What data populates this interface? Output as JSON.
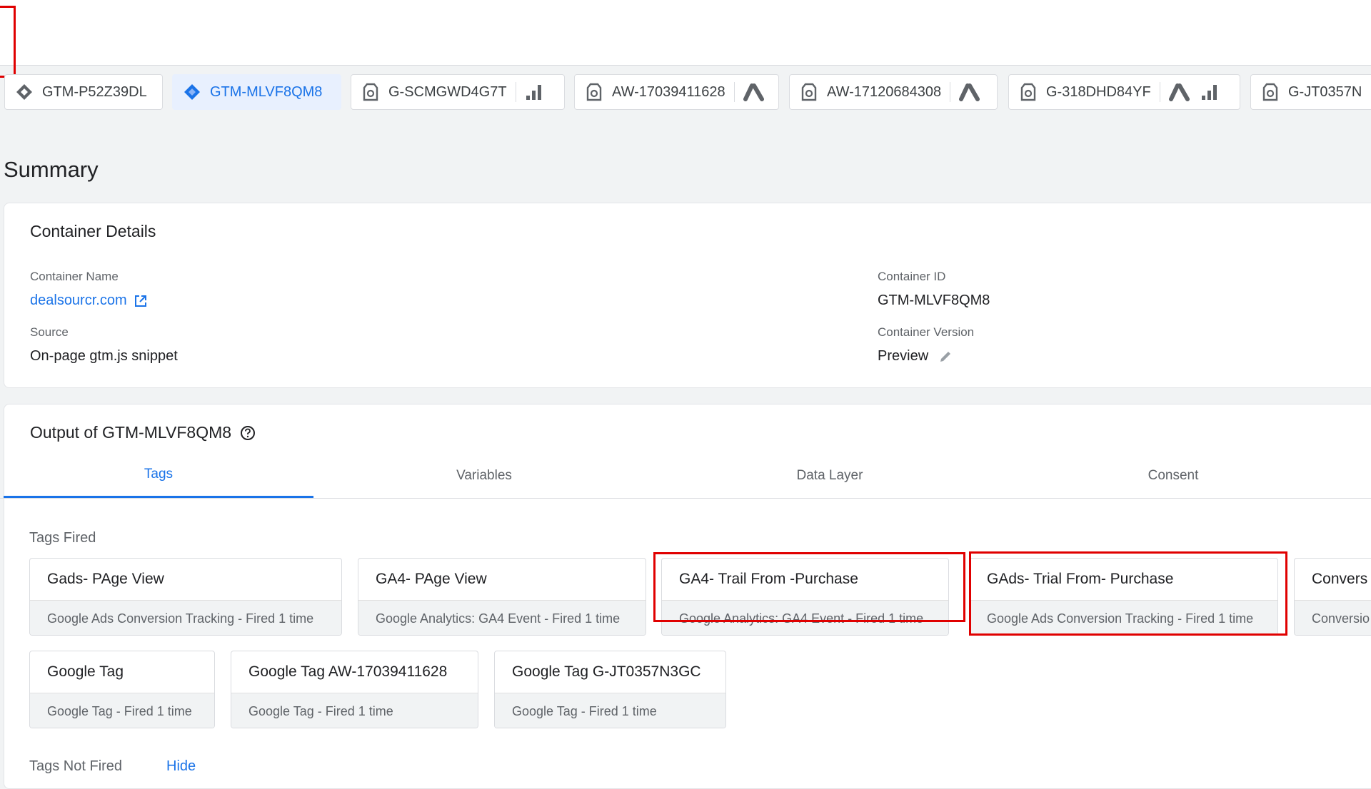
{
  "containers": [
    {
      "id": "GTM-P52Z39DL",
      "icon": "gtm-diamond-icon",
      "active": false
    },
    {
      "id": "GTM-MLVF8QM8",
      "icon": "gtm-diamond-icon",
      "active": true
    },
    {
      "id": "G-SCMGWD4G7T",
      "icon": "google-tag-icon",
      "tail": [
        "analytics-bars-icon"
      ]
    },
    {
      "id": "AW-17039411628",
      "icon": "google-tag-icon",
      "tail": [
        "google-ads-icon"
      ]
    },
    {
      "id": "AW-17120684308",
      "icon": "google-tag-icon",
      "tail": [
        "google-ads-icon"
      ]
    },
    {
      "id": "G-318DHD84YF",
      "icon": "google-tag-icon",
      "tail": [
        "google-ads-icon",
        "analytics-bars-icon"
      ]
    },
    {
      "id": "G-JT0357N",
      "icon": "google-tag-icon"
    }
  ],
  "summary": {
    "title": "Summary"
  },
  "container_details": {
    "title": "Container Details",
    "name_label": "Container Name",
    "name_value": "dealsourcr.com",
    "id_label": "Container ID",
    "id_value": "GTM-MLVF8QM8",
    "source_label": "Source",
    "source_value": "On-page gtm.js snippet",
    "version_label": "Container Version",
    "version_value": "Preview"
  },
  "output": {
    "title": "Output of GTM-MLVF8QM8",
    "tabs": [
      "Tags",
      "Variables",
      "Data Layer",
      "Consent"
    ],
    "active_tab": "Tags",
    "fired_label": "Tags Fired",
    "not_fired_label": "Tags Not Fired",
    "hide_label": "Hide",
    "fired_row1": [
      {
        "name": "Gads- PAge View",
        "sub": "Google Ads Conversion Tracking - Fired 1 time"
      },
      {
        "name": "GA4- PAge View",
        "sub": "Google Analytics: GA4 Event - Fired 1 time"
      },
      {
        "name": "GA4- Trail From -Purchase",
        "sub": "Google Analytics: GA4 Event - Fired 1 time"
      },
      {
        "name": "GAds- Trial From- Purchase",
        "sub": "Google Ads Conversion Tracking - Fired 1 time"
      },
      {
        "name": "Convers",
        "sub": "Conversio"
      }
    ],
    "fired_row2": [
      {
        "name": "Google Tag",
        "sub": "Google Tag - Fired 1 time"
      },
      {
        "name": "Google Tag AW-17039411628",
        "sub": "Google Tag - Fired 1 time"
      },
      {
        "name": "Google Tag G-JT0357N3GC",
        "sub": "Google Tag - Fired 1 time"
      }
    ]
  },
  "colors": {
    "accent": "#1a73e8",
    "highlight": "#e00000"
  }
}
